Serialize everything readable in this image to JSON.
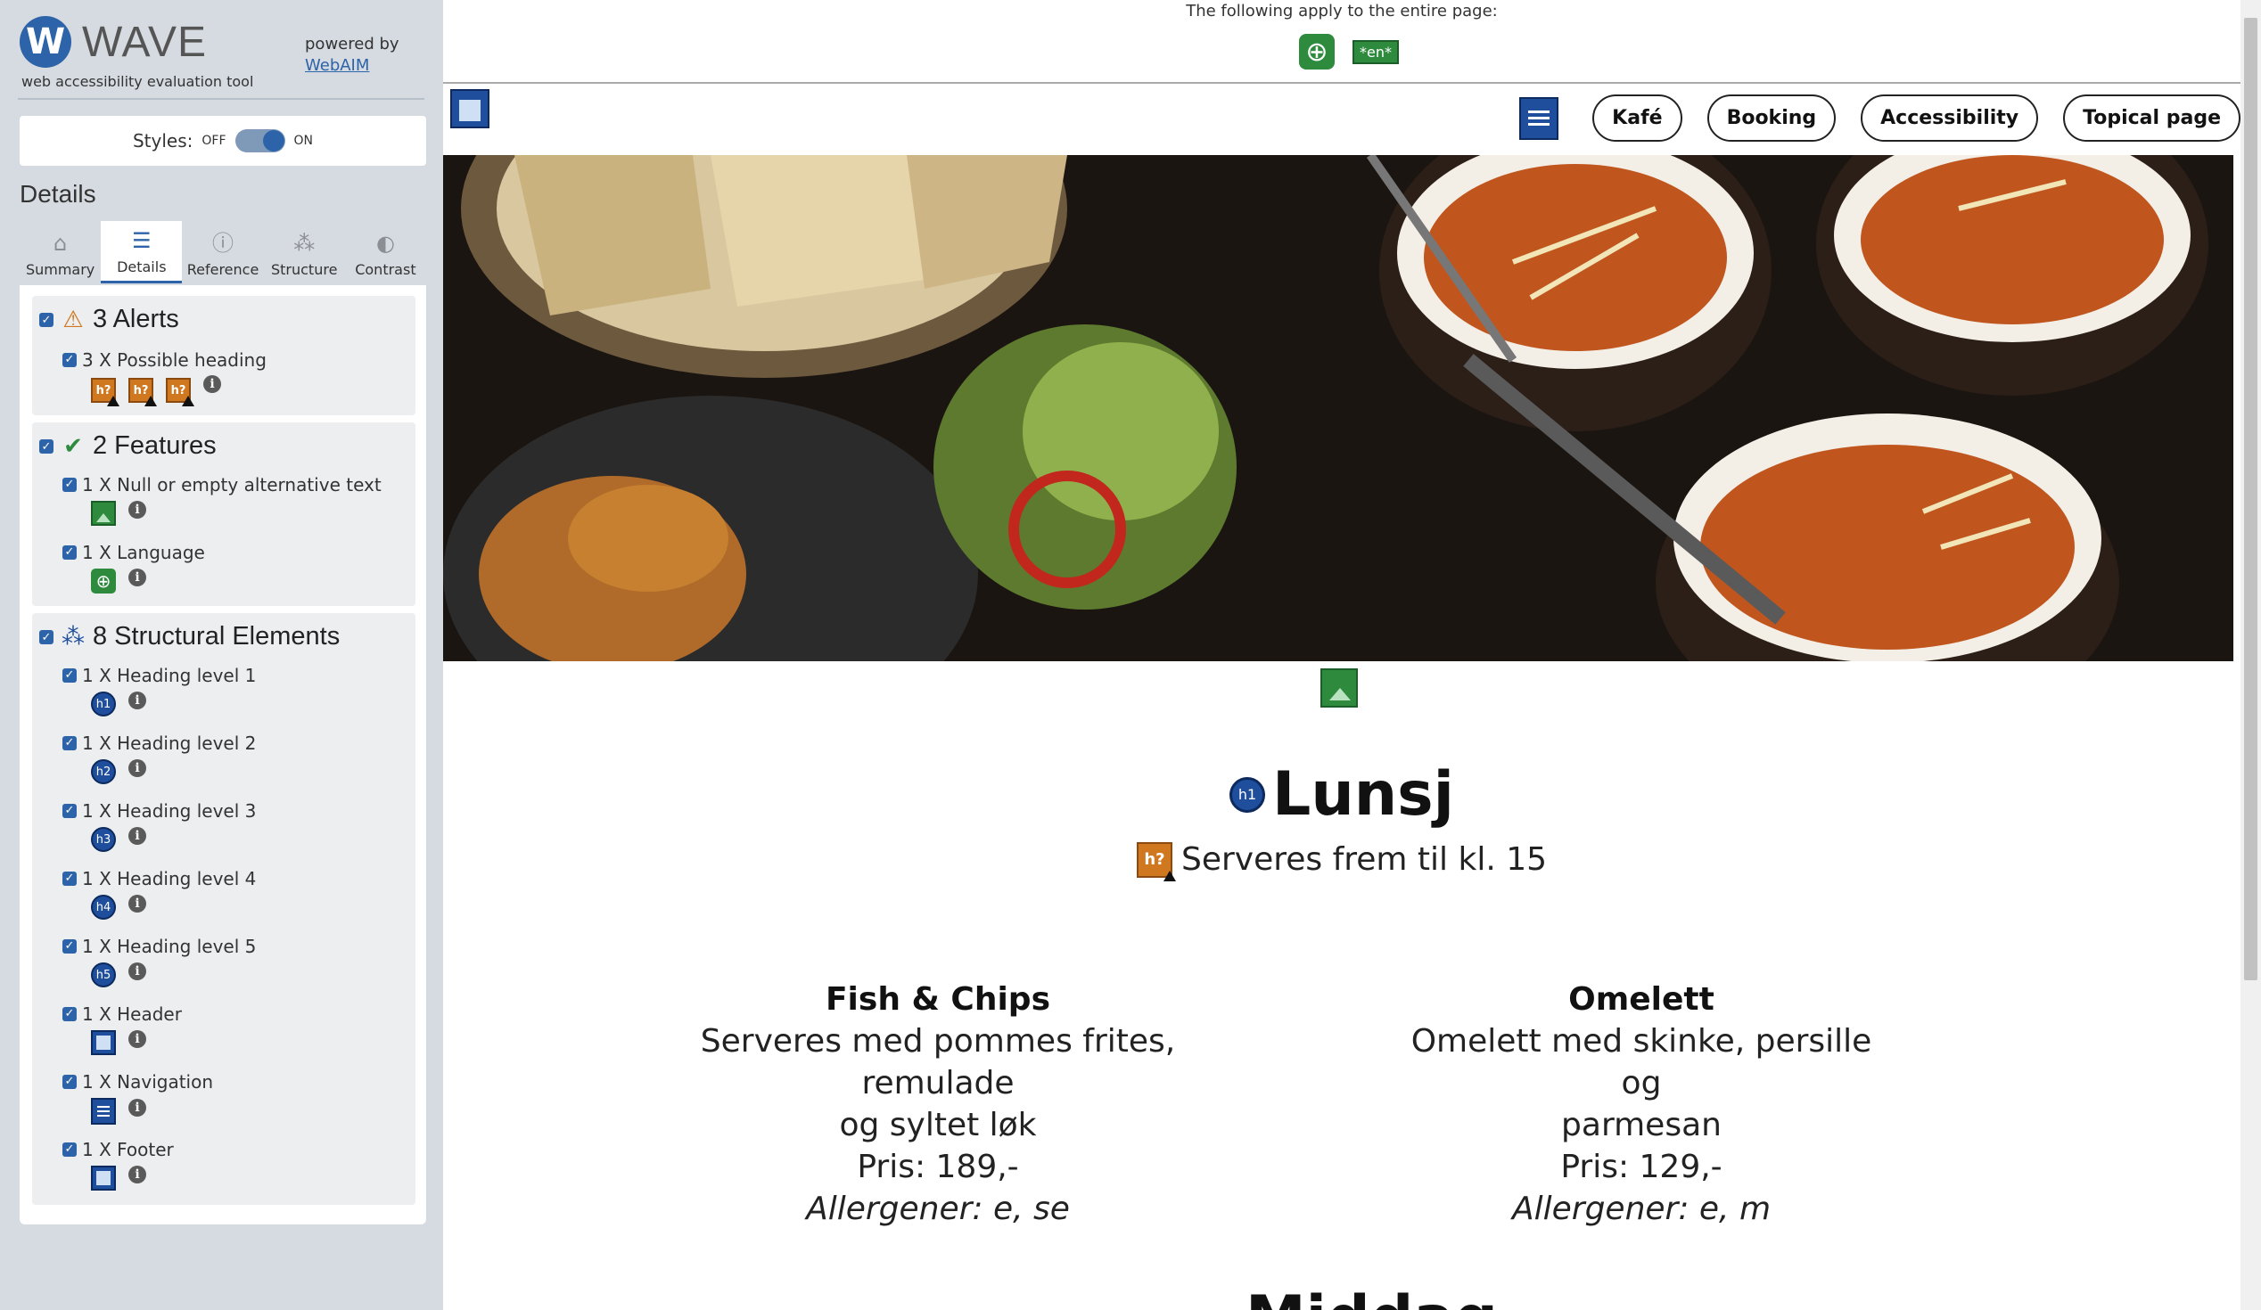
{
  "wave": {
    "logo_letter": "W",
    "logo_text": "WAVE",
    "logo_sub": "web accessibility evaluation tool",
    "powered_by": "powered by",
    "webaim": "WebAIM",
    "styles_label": "Styles:",
    "off": "OFF",
    "on": "ON",
    "details_heading": "Details",
    "tabs": [
      {
        "label": "Summary",
        "icon": "home-icon"
      },
      {
        "label": "Details",
        "icon": "list-icon"
      },
      {
        "label": "Reference",
        "icon": "info-icon"
      },
      {
        "label": "Structure",
        "icon": "structure-icon"
      },
      {
        "label": "Contrast",
        "icon": "contrast-icon"
      }
    ],
    "alerts": {
      "title": "3 Alerts",
      "items": [
        {
          "label": "3 X Possible heading"
        }
      ]
    },
    "features": {
      "title": "2 Features",
      "items": [
        {
          "label": "1 X Null or empty alternative text"
        },
        {
          "label": "1 X Language"
        }
      ]
    },
    "structure": {
      "title": "8 Structural Elements",
      "items": [
        {
          "label": "1 X Heading level 1",
          "badge": "h1"
        },
        {
          "label": "1 X Heading level 2",
          "badge": "h2"
        },
        {
          "label": "1 X Heading level 3",
          "badge": "h3"
        },
        {
          "label": "1 X Heading level 4",
          "badge": "h4"
        },
        {
          "label": "1 X Heading level 5",
          "badge": "h5"
        },
        {
          "label": "1 X Header"
        },
        {
          "label": "1 X Navigation"
        },
        {
          "label": "1 X Footer"
        }
      ]
    },
    "possible_heading_badge": "h?",
    "colors": {
      "accent": "#2d63a8",
      "alert": "#d0781f",
      "feature": "#2e8b3e",
      "structure": "#1f4e9c"
    }
  },
  "page": {
    "applies_text": "The following apply to the entire page:",
    "lang_tag": "*en*",
    "nav": [
      "Kafé",
      "Booking",
      "Accessibility",
      "Topical page"
    ],
    "h1_badge": "h1",
    "h1": "Lunsj",
    "subtitle": "Serveres frem til kl. 15",
    "menu": [
      {
        "title": "Fish & Chips",
        "line1": "Serveres med pommes frites, remulade",
        "line2": "og syltet løk",
        "price": "Pris: 189,-",
        "allergens": "Allergener: e, se"
      },
      {
        "title": "Omelett",
        "line1": "Omelett med skinke, persille og",
        "line2": "parmesan",
        "price": "Pris: 129,-",
        "allergens": "Allergener: e, m"
      }
    ],
    "next_heading": "Middag"
  }
}
